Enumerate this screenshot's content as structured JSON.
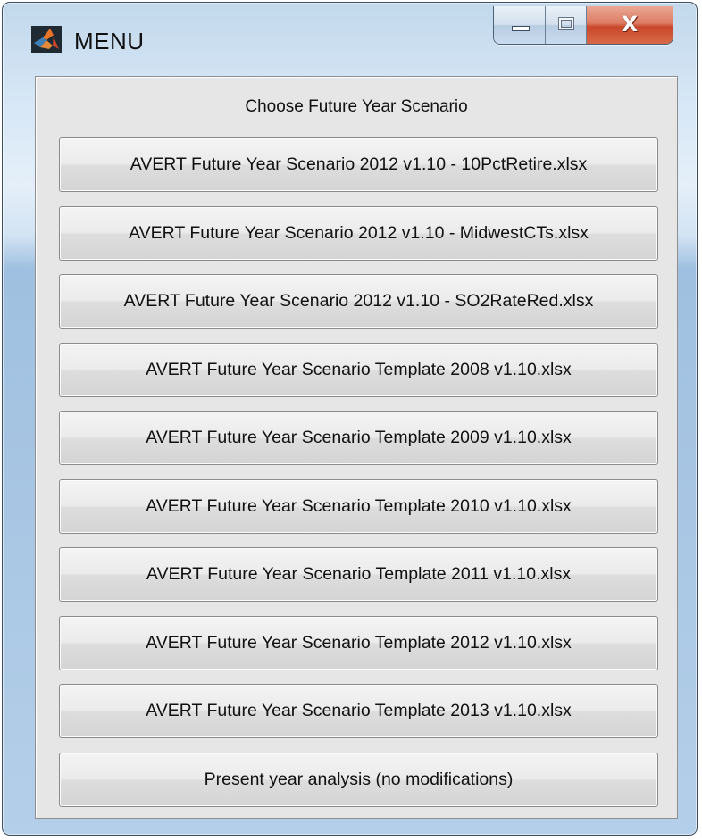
{
  "window": {
    "title": "MENU",
    "app_icon": "matlab-logo-icon",
    "caption_buttons": {
      "minimize_icon": "minimize-icon",
      "maximize_icon": "maximize-icon",
      "close_label": "X"
    }
  },
  "menu": {
    "heading": "Choose Future Year Scenario",
    "options": [
      {
        "label": "AVERT Future Year Scenario 2012 v1.10 - 10PctRetire.xlsx"
      },
      {
        "label": "AVERT Future Year Scenario 2012 v1.10 - MidwestCTs.xlsx"
      },
      {
        "label": "AVERT Future Year Scenario 2012 v1.10 - SO2RateRed.xlsx"
      },
      {
        "label": "AVERT Future Year Scenario Template 2008 v1.10.xlsx"
      },
      {
        "label": "AVERT Future Year Scenario Template 2009 v1.10.xlsx"
      },
      {
        "label": "AVERT Future Year Scenario Template 2010 v1.10.xlsx"
      },
      {
        "label": "AVERT Future Year Scenario Template 2011 v1.10.xlsx"
      },
      {
        "label": "AVERT Future Year Scenario Template 2012 v1.10.xlsx"
      },
      {
        "label": "AVERT Future Year Scenario Template 2013 v1.10.xlsx"
      },
      {
        "label": "Present year analysis (no modifications)"
      }
    ]
  },
  "colors": {
    "client_background": "#e6e6e6",
    "close_button": "#c8462a"
  }
}
